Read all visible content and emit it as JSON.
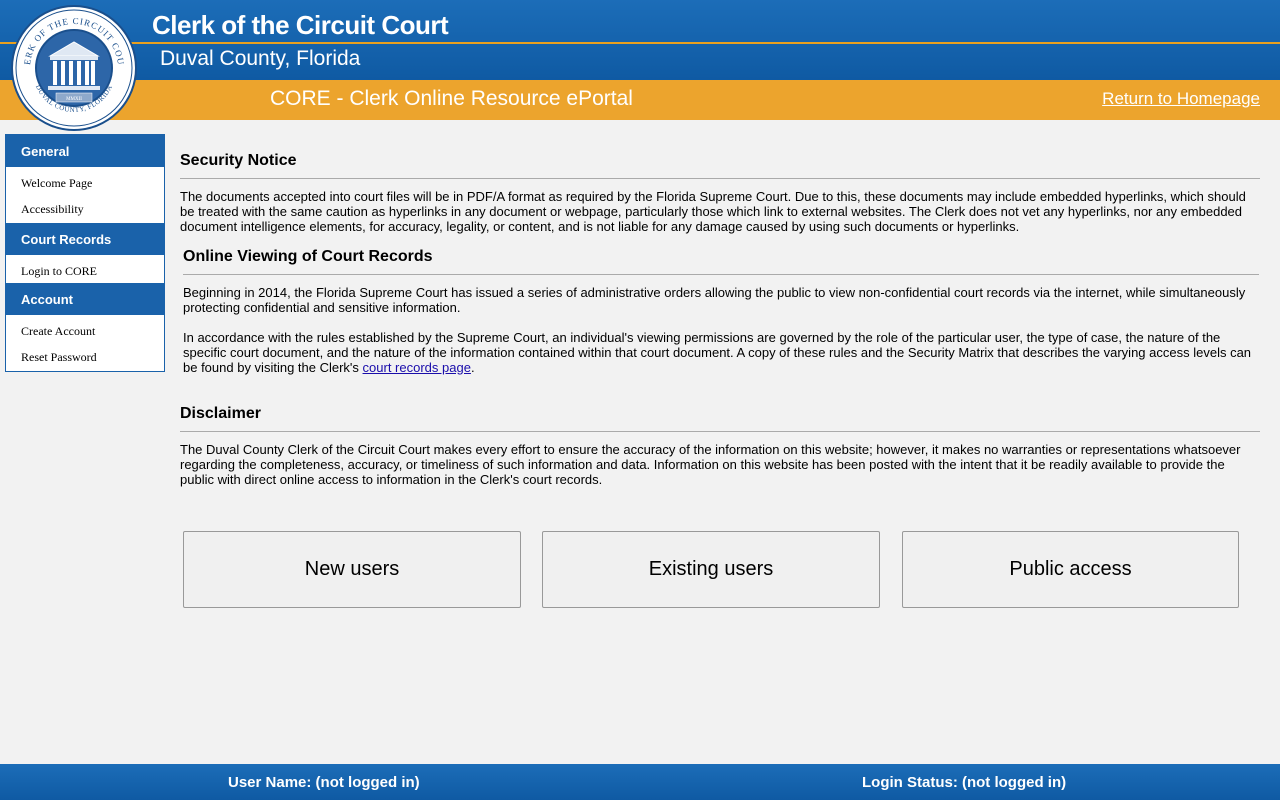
{
  "header": {
    "title": "Clerk of the Circuit Court",
    "subtitle": "Duval County, Florida",
    "portal_name": "CORE - Clerk Online Resource ePortal",
    "home_link": "Return to Homepage",
    "seal": {
      "top_text": "CLERK OF THE CIRCUIT COURT",
      "bottom_text": "DUVAL COUNTY, FLORIDA",
      "year": "MMXII"
    }
  },
  "sidebar": {
    "sections": [
      {
        "heading": "General",
        "items": [
          "Welcome Page",
          "Accessibility"
        ]
      },
      {
        "heading": "Court Records",
        "items": [
          "Login to CORE"
        ]
      },
      {
        "heading": "Account",
        "items": [
          "Create Account",
          "Reset Password"
        ]
      }
    ]
  },
  "security": {
    "heading": "Security Notice",
    "text": "The documents accepted into court files will be in PDF/A format as required by the Florida Supreme Court. Due to this, these documents may include embedded hyperlinks, which should be treated with the same caution as hyperlinks in any document or webpage, particularly those which link to external websites. The Clerk does not vet any hyperlinks, nor any embedded document intelligence elements, for accuracy, legality, or content, and is not liable for any damage caused by using such documents or hyperlinks."
  },
  "online_viewing": {
    "heading": "Online Viewing of Court Records",
    "para1": "Beginning in 2014, the Florida Supreme Court has issued a series of administrative orders allowing the public to view non-confidential court records via the internet, while simultaneously protecting confidential and sensitive information.",
    "para2": "In accordance with the rules established by the Supreme Court, an individual's viewing permissions are governed by the role of the particular user, the type of case, the nature of the specific court document, and the nature of the information contained within that court document. A copy of these rules and the Security Matrix that describes the varying access levels can be found by visiting the Clerk's ",
    "link": "court records page",
    "para2_end": "."
  },
  "disclaimer": {
    "heading": "Disclaimer",
    "text": "The Duval County Clerk of the Circuit Court makes every effort to ensure the accuracy of the information on this website; however, it makes no warranties or representations whatsoever regarding the completeness, accuracy, or timeliness of such information and data. Information on this website has been posted with the intent that it be readily available to provide the public with direct online access to information in the Clerk's court records."
  },
  "buttons": {
    "new_users": "New users",
    "existing_users": "Existing users",
    "public_access": "Public access"
  },
  "footer": {
    "user_name": "User Name: (not logged in)",
    "login_status": "Login Status: (not logged in)"
  },
  "colors": {
    "primary_blue": "#1a62aa",
    "accent_orange": "#eca42d",
    "background": "#f2f2f2"
  }
}
